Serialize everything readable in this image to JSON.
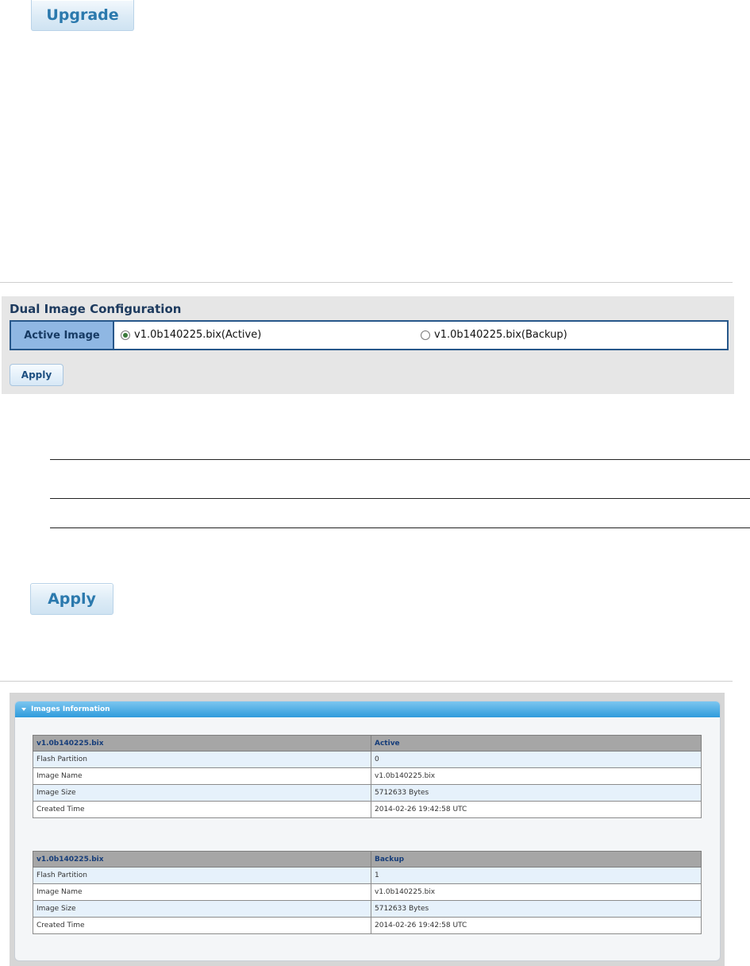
{
  "upgrade": {
    "label": "Upgrade"
  },
  "dual_image": {
    "title": "Dual Image Configuration",
    "field_label": "Active Image",
    "options": [
      {
        "label": "v1.0b140225.bix(Active)",
        "checked": true
      },
      {
        "label": "v1.0b140225.bix(Backup)",
        "checked": false
      }
    ],
    "apply_label": "Apply"
  },
  "apply_big": {
    "label": "Apply"
  },
  "images_info": {
    "header": "Images Information",
    "tables": [
      {
        "header": [
          "v1.0b140225.bix",
          "Active"
        ],
        "rows": [
          [
            "Flash Partition",
            "0"
          ],
          [
            "Image Name",
            "v1.0b140225.bix"
          ],
          [
            "Image Size",
            "5712633 Bytes"
          ],
          [
            "Created Time",
            "2014-02-26 19:42:58 UTC"
          ]
        ]
      },
      {
        "header": [
          "v1.0b140225.bix",
          "Backup"
        ],
        "rows": [
          [
            "Flash Partition",
            "1"
          ],
          [
            "Image Name",
            "v1.0b140225.bix"
          ],
          [
            "Image Size",
            "5712633 Bytes"
          ],
          [
            "Created Time",
            "2014-02-26 19:42:58 UTC"
          ]
        ]
      }
    ]
  }
}
